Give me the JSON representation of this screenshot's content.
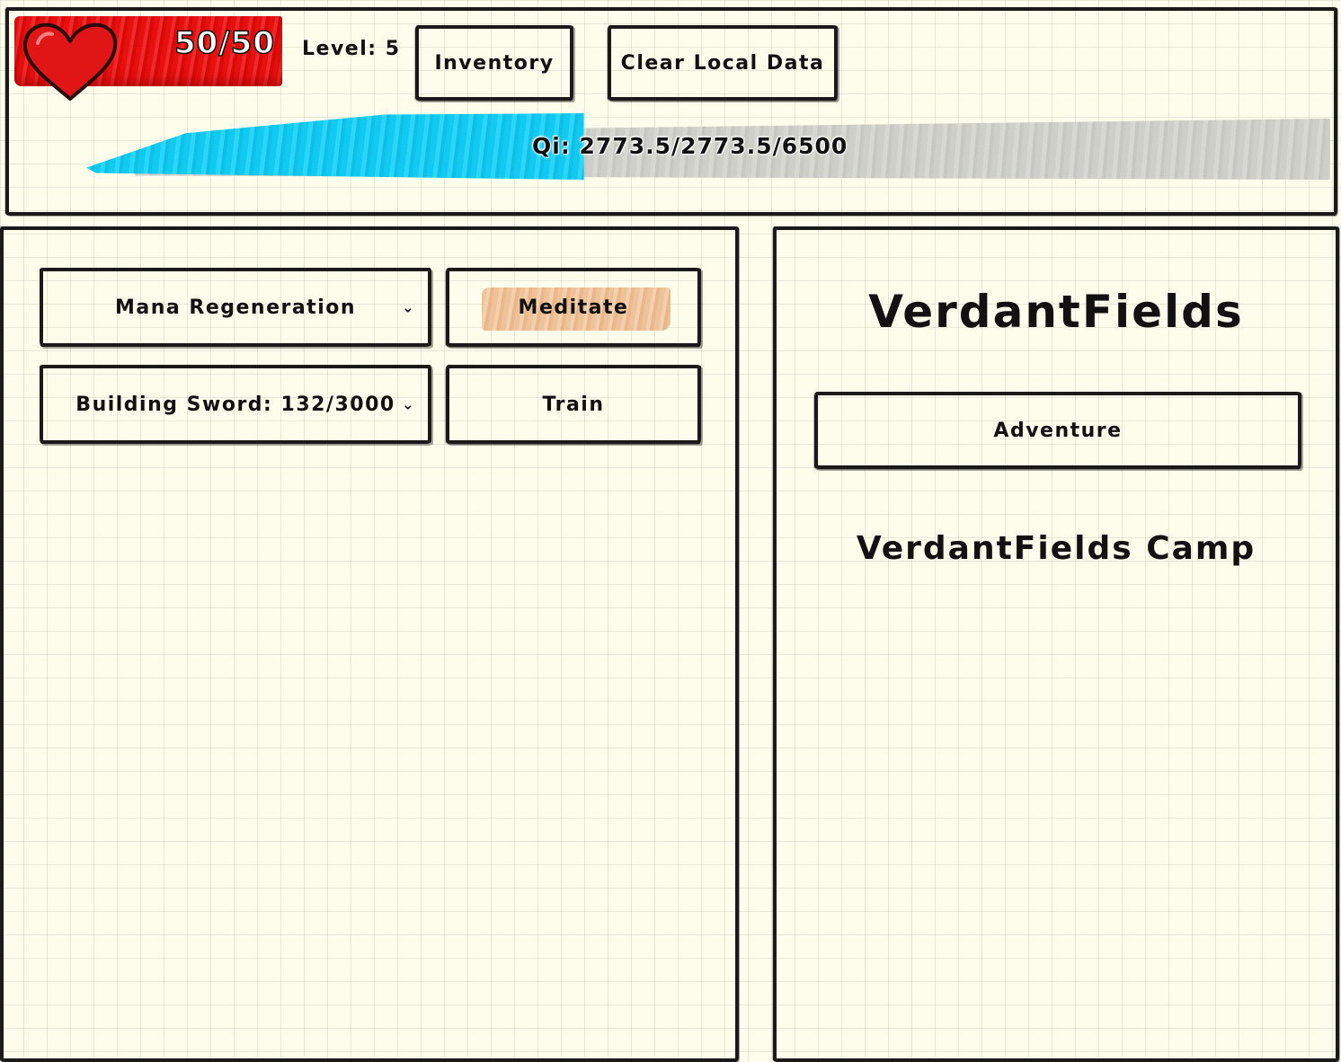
{
  "header": {
    "health": {
      "current": 50,
      "max": 50,
      "text": "50/50",
      "color": "#e61010"
    },
    "level_text": "Level: 5",
    "inventory_label": "Inventory",
    "clear_data_label": "Clear Local Data",
    "qi": {
      "text": "Qi: 2773.5/2773.5/6500",
      "fill_fraction": 0.4,
      "fill_color": "#12c9ef",
      "track_color": "#cfcfc9"
    }
  },
  "left_panel": {
    "skill_select": {
      "selected": "Mana Regeneration",
      "icon": "chevron-down-icon"
    },
    "meditate_label": "Meditate",
    "meditate_highlight_color": "#efc39a",
    "weapon_select": {
      "selected": "Building Sword: 132/3000",
      "icon": "chevron-down-icon"
    },
    "train_label": "Train"
  },
  "right_panel": {
    "zone_title": "VerdantFields",
    "adventure_label": "Adventure",
    "camp_title": "VerdantFields Camp"
  },
  "colors": {
    "background": "#fdfdec",
    "ink": "#1a1a1a"
  }
}
